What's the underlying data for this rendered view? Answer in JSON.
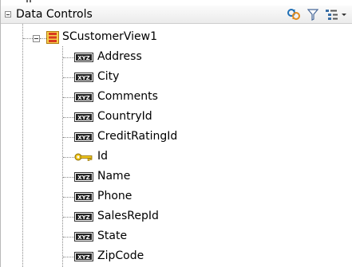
{
  "panel": {
    "title": "Data Controls"
  },
  "header_buttons": [
    {
      "icon": "refresh-icon"
    },
    {
      "icon": "filter-icon"
    },
    {
      "icon": "tree-options-icon"
    }
  ],
  "tree": {
    "view_object": "SCustomerView1",
    "attributes": [
      {
        "label": "Address",
        "icon": "attribute-xyz-icon"
      },
      {
        "label": "City",
        "icon": "attribute-xyz-icon"
      },
      {
        "label": "Comments",
        "icon": "attribute-xyz-icon"
      },
      {
        "label": "CountryId",
        "icon": "attribute-xyz-icon"
      },
      {
        "label": "CreditRatingId",
        "icon": "attribute-xyz-icon"
      },
      {
        "label": "Id",
        "icon": "key-icon"
      },
      {
        "label": "Name",
        "icon": "attribute-xyz-icon"
      },
      {
        "label": "Phone",
        "icon": "attribute-xyz-icon"
      },
      {
        "label": "SalesRepId",
        "icon": "attribute-xyz-icon"
      },
      {
        "label": "State",
        "icon": "attribute-xyz-icon"
      },
      {
        "label": "ZipCode",
        "icon": "attribute-xyz-icon"
      }
    ]
  }
}
